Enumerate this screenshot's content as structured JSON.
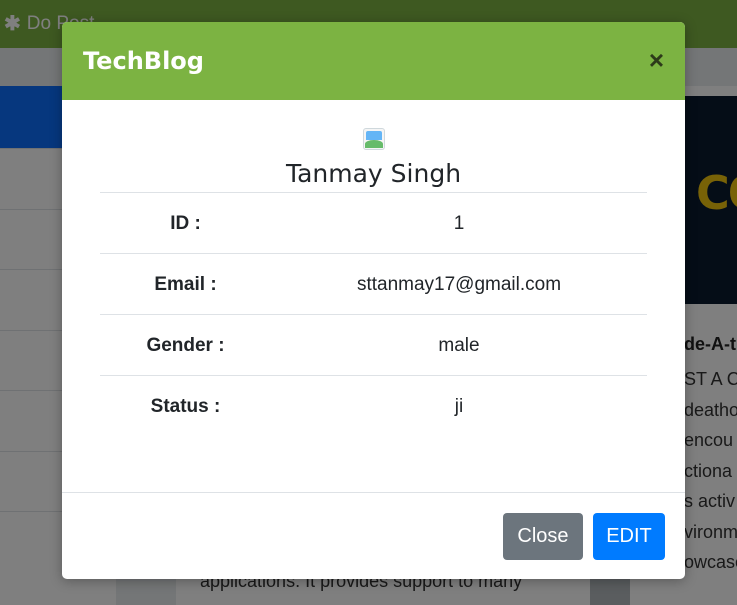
{
  "background": {
    "nav_item": "Do Post",
    "card_heading": "de-A-t",
    "card_lines": [
      "ST A C",
      "deatho",
      "encou",
      "ctiona",
      "s activ",
      "vironm",
      "owcase"
    ],
    "bottom_text": "applications. It provides support to many"
  },
  "modal": {
    "title": "TechBlog",
    "close_icon": "×",
    "profile": {
      "name": "Tanmay Singh",
      "rows": [
        {
          "label": "ID :",
          "value": "1"
        },
        {
          "label": "Email :",
          "value": "sttanmay17@gmail.com"
        },
        {
          "label": "Gender :",
          "value": "male"
        },
        {
          "label": "Status :",
          "value": "ji"
        }
      ]
    },
    "footer": {
      "close_label": "Close",
      "edit_label": "EDIT"
    }
  },
  "colors": {
    "header_green": "#7cb342",
    "close_button": "#6c757d",
    "edit_button": "#007bff"
  }
}
